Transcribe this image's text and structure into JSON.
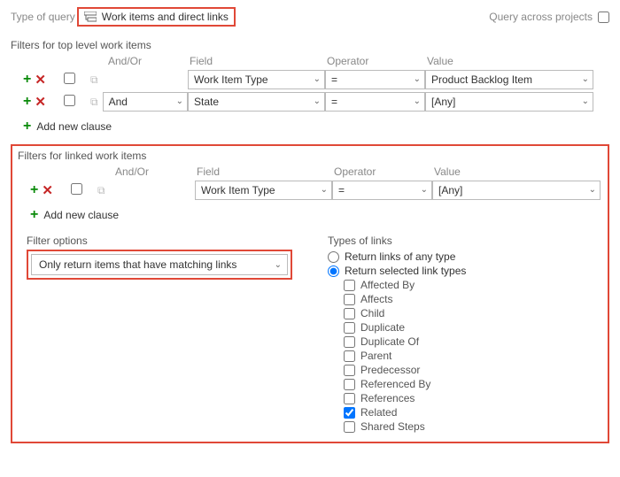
{
  "top": {
    "type_of_query_label": "Type of query",
    "query_type": "Work items and direct links",
    "query_across_label": "Query across projects"
  },
  "top_filters": {
    "title": "Filters for top level work items",
    "headers": {
      "andor": "And/Or",
      "field": "Field",
      "operator": "Operator",
      "value": "Value"
    },
    "rows": [
      {
        "andor": "",
        "field": "Work Item Type",
        "operator": "=",
        "value": "Product Backlog Item",
        "has_andor_select": false
      },
      {
        "andor": "And",
        "field": "State",
        "operator": "=",
        "value": "[Any]",
        "has_andor_select": true
      }
    ],
    "add_clause": "Add new clause"
  },
  "linked_filters": {
    "title": "Filters for linked work items",
    "headers": {
      "andor": "And/Or",
      "field": "Field",
      "operator": "Operator",
      "value": "Value"
    },
    "rows": [
      {
        "andor": "",
        "field": "Work Item Type",
        "operator": "=",
        "value": "[Any]",
        "has_andor_select": false
      }
    ],
    "add_clause": "Add new clause",
    "filter_options_label": "Filter options",
    "filter_options_value": "Only return items that have matching links",
    "types_of_links_label": "Types of links",
    "radio_any": "Return links of any type",
    "radio_selected": "Return selected link types",
    "radio_choice": "selected",
    "link_types": [
      {
        "label": "Affected By",
        "checked": false
      },
      {
        "label": "Affects",
        "checked": false
      },
      {
        "label": "Child",
        "checked": false
      },
      {
        "label": "Duplicate",
        "checked": false
      },
      {
        "label": "Duplicate Of",
        "checked": false
      },
      {
        "label": "Parent",
        "checked": false
      },
      {
        "label": "Predecessor",
        "checked": false
      },
      {
        "label": "Referenced By",
        "checked": false
      },
      {
        "label": "References",
        "checked": false
      },
      {
        "label": "Related",
        "checked": true
      },
      {
        "label": "Shared Steps",
        "checked": false
      }
    ]
  }
}
